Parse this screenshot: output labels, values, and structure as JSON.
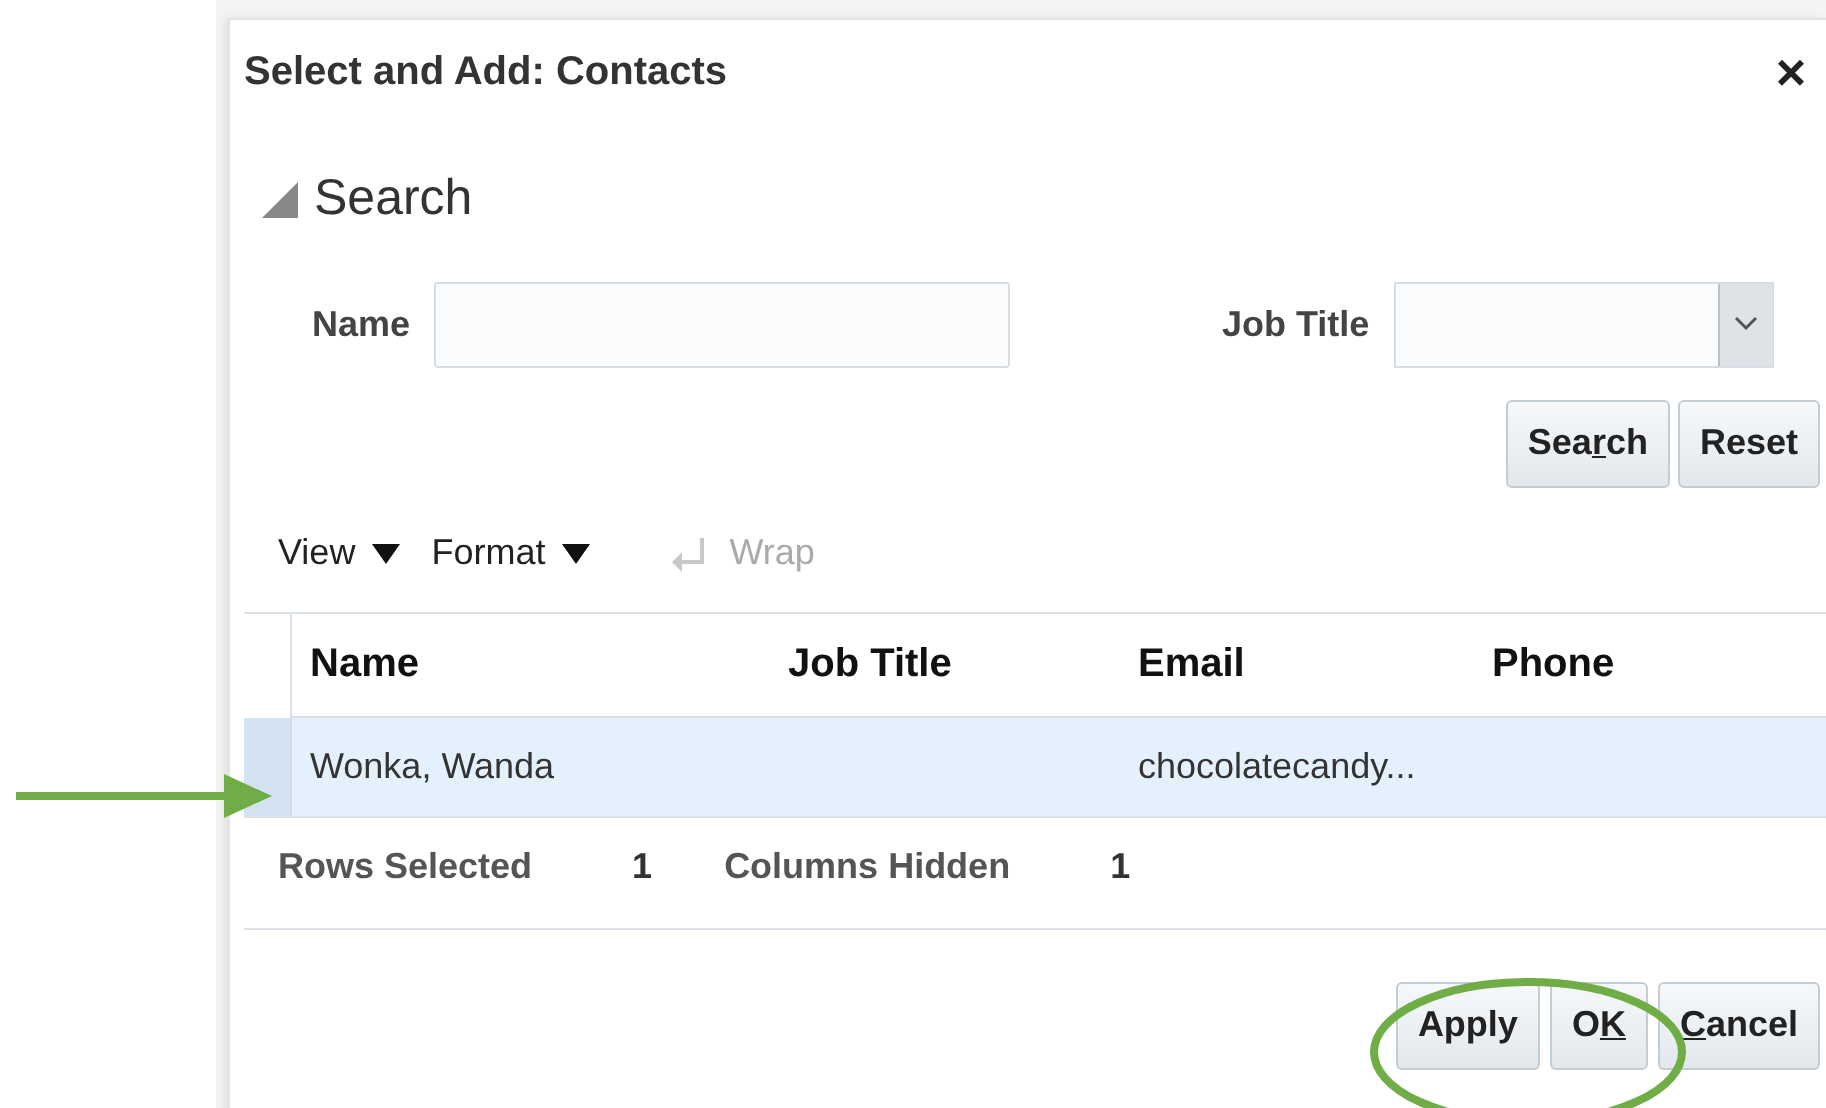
{
  "dialog": {
    "title": "Select and Add: Contacts",
    "close": "×"
  },
  "search": {
    "heading": "Search",
    "expanded": true,
    "fields": [
      {
        "label": "Name",
        "kind": "text"
      },
      {
        "label": "Job Title",
        "kind": "select"
      }
    ],
    "buttons": [
      {
        "label_parts": [
          {
            "text": "Sea",
            "underlined": false
          },
          {
            "text": "r",
            "underlined": true
          },
          {
            "text": "ch",
            "underlined": false
          }
        ]
      },
      {
        "label_parts": [
          {
            "text": "Reset",
            "underlined": false
          }
        ]
      }
    ]
  },
  "toolbar": [
    {
      "label": "View",
      "kind": "menu",
      "disabled": false
    },
    {
      "label": "Format",
      "kind": "menu",
      "disabled": false
    },
    {
      "label": "Wrap",
      "kind": "toggle",
      "disabled": true
    }
  ],
  "table": {
    "columns": [
      "Name",
      "Job Title",
      "Email",
      "Phone"
    ],
    "rows": [
      {
        "cells": [
          "Wonka, Wanda",
          "",
          "chocolatecandy...",
          ""
        ],
        "selected": true
      }
    ]
  },
  "status": [
    {
      "label": "Rows Selected",
      "value": "1"
    },
    {
      "label": "Columns Hidden",
      "value": "1"
    }
  ],
  "footer_buttons": [
    {
      "label_parts": [
        {
          "text": "Apply",
          "underlined": false
        }
      ]
    },
    {
      "label_parts": [
        {
          "text": "O",
          "underlined": false
        },
        {
          "text": "K",
          "underlined": true
        }
      ]
    },
    {
      "label_parts": [
        {
          "text": "C",
          "underlined": true
        },
        {
          "text": "ancel",
          "underlined": false
        }
      ]
    }
  ],
  "arrow": {
    "color": "#70ad47"
  },
  "highlight_ellipse": {
    "color": "#70ad47"
  }
}
